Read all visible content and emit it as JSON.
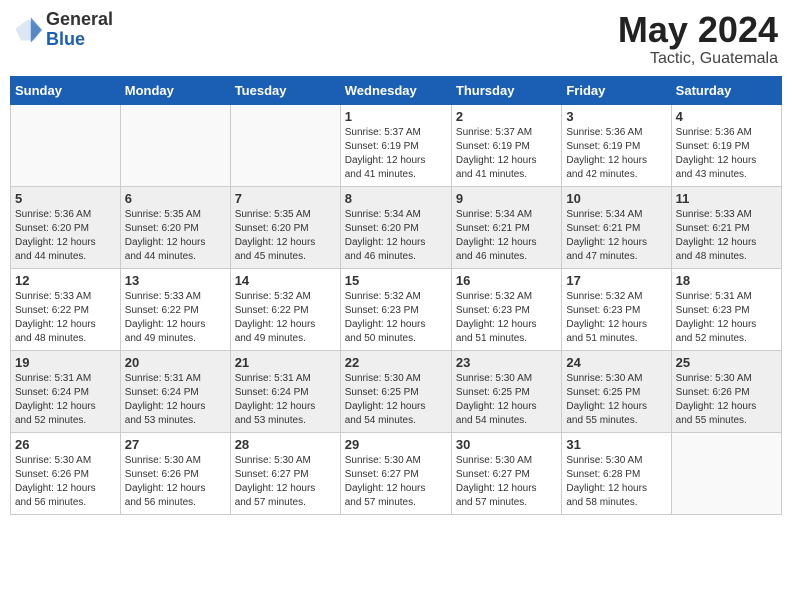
{
  "header": {
    "logo_general": "General",
    "logo_blue": "Blue",
    "title": "May 2024",
    "subtitle": "Tactic, Guatemala"
  },
  "weekdays": [
    "Sunday",
    "Monday",
    "Tuesday",
    "Wednesday",
    "Thursday",
    "Friday",
    "Saturday"
  ],
  "weeks": [
    [
      {
        "day": "",
        "detail": ""
      },
      {
        "day": "",
        "detail": ""
      },
      {
        "day": "",
        "detail": ""
      },
      {
        "day": "1",
        "detail": "Sunrise: 5:37 AM\nSunset: 6:19 PM\nDaylight: 12 hours\nand 41 minutes."
      },
      {
        "day": "2",
        "detail": "Sunrise: 5:37 AM\nSunset: 6:19 PM\nDaylight: 12 hours\nand 41 minutes."
      },
      {
        "day": "3",
        "detail": "Sunrise: 5:36 AM\nSunset: 6:19 PM\nDaylight: 12 hours\nand 42 minutes."
      },
      {
        "day": "4",
        "detail": "Sunrise: 5:36 AM\nSunset: 6:19 PM\nDaylight: 12 hours\nand 43 minutes."
      }
    ],
    [
      {
        "day": "5",
        "detail": "Sunrise: 5:36 AM\nSunset: 6:20 PM\nDaylight: 12 hours\nand 44 minutes."
      },
      {
        "day": "6",
        "detail": "Sunrise: 5:35 AM\nSunset: 6:20 PM\nDaylight: 12 hours\nand 44 minutes."
      },
      {
        "day": "7",
        "detail": "Sunrise: 5:35 AM\nSunset: 6:20 PM\nDaylight: 12 hours\nand 45 minutes."
      },
      {
        "day": "8",
        "detail": "Sunrise: 5:34 AM\nSunset: 6:20 PM\nDaylight: 12 hours\nand 46 minutes."
      },
      {
        "day": "9",
        "detail": "Sunrise: 5:34 AM\nSunset: 6:21 PM\nDaylight: 12 hours\nand 46 minutes."
      },
      {
        "day": "10",
        "detail": "Sunrise: 5:34 AM\nSunset: 6:21 PM\nDaylight: 12 hours\nand 47 minutes."
      },
      {
        "day": "11",
        "detail": "Sunrise: 5:33 AM\nSunset: 6:21 PM\nDaylight: 12 hours\nand 48 minutes."
      }
    ],
    [
      {
        "day": "12",
        "detail": "Sunrise: 5:33 AM\nSunset: 6:22 PM\nDaylight: 12 hours\nand 48 minutes."
      },
      {
        "day": "13",
        "detail": "Sunrise: 5:33 AM\nSunset: 6:22 PM\nDaylight: 12 hours\nand 49 minutes."
      },
      {
        "day": "14",
        "detail": "Sunrise: 5:32 AM\nSunset: 6:22 PM\nDaylight: 12 hours\nand 49 minutes."
      },
      {
        "day": "15",
        "detail": "Sunrise: 5:32 AM\nSunset: 6:23 PM\nDaylight: 12 hours\nand 50 minutes."
      },
      {
        "day": "16",
        "detail": "Sunrise: 5:32 AM\nSunset: 6:23 PM\nDaylight: 12 hours\nand 51 minutes."
      },
      {
        "day": "17",
        "detail": "Sunrise: 5:32 AM\nSunset: 6:23 PM\nDaylight: 12 hours\nand 51 minutes."
      },
      {
        "day": "18",
        "detail": "Sunrise: 5:31 AM\nSunset: 6:23 PM\nDaylight: 12 hours\nand 52 minutes."
      }
    ],
    [
      {
        "day": "19",
        "detail": "Sunrise: 5:31 AM\nSunset: 6:24 PM\nDaylight: 12 hours\nand 52 minutes."
      },
      {
        "day": "20",
        "detail": "Sunrise: 5:31 AM\nSunset: 6:24 PM\nDaylight: 12 hours\nand 53 minutes."
      },
      {
        "day": "21",
        "detail": "Sunrise: 5:31 AM\nSunset: 6:24 PM\nDaylight: 12 hours\nand 53 minutes."
      },
      {
        "day": "22",
        "detail": "Sunrise: 5:30 AM\nSunset: 6:25 PM\nDaylight: 12 hours\nand 54 minutes."
      },
      {
        "day": "23",
        "detail": "Sunrise: 5:30 AM\nSunset: 6:25 PM\nDaylight: 12 hours\nand 54 minutes."
      },
      {
        "day": "24",
        "detail": "Sunrise: 5:30 AM\nSunset: 6:25 PM\nDaylight: 12 hours\nand 55 minutes."
      },
      {
        "day": "25",
        "detail": "Sunrise: 5:30 AM\nSunset: 6:26 PM\nDaylight: 12 hours\nand 55 minutes."
      }
    ],
    [
      {
        "day": "26",
        "detail": "Sunrise: 5:30 AM\nSunset: 6:26 PM\nDaylight: 12 hours\nand 56 minutes."
      },
      {
        "day": "27",
        "detail": "Sunrise: 5:30 AM\nSunset: 6:26 PM\nDaylight: 12 hours\nand 56 minutes."
      },
      {
        "day": "28",
        "detail": "Sunrise: 5:30 AM\nSunset: 6:27 PM\nDaylight: 12 hours\nand 57 minutes."
      },
      {
        "day": "29",
        "detail": "Sunrise: 5:30 AM\nSunset: 6:27 PM\nDaylight: 12 hours\nand 57 minutes."
      },
      {
        "day": "30",
        "detail": "Sunrise: 5:30 AM\nSunset: 6:27 PM\nDaylight: 12 hours\nand 57 minutes."
      },
      {
        "day": "31",
        "detail": "Sunrise: 5:30 AM\nSunset: 6:28 PM\nDaylight: 12 hours\nand 58 minutes."
      },
      {
        "day": "",
        "detail": ""
      }
    ]
  ]
}
